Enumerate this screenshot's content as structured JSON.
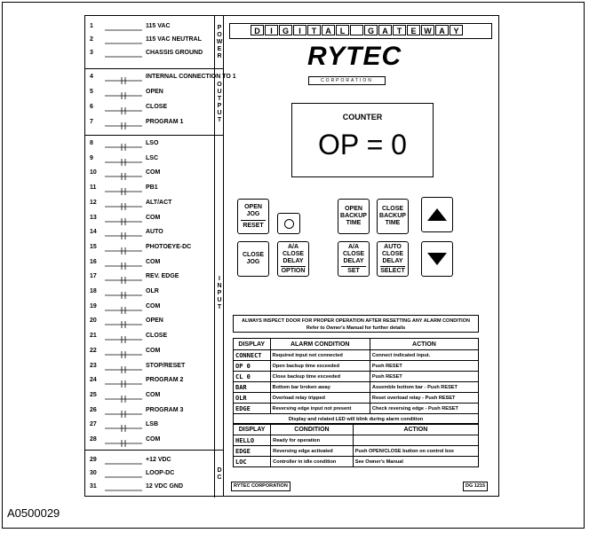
{
  "figure_id": "A0500029",
  "power": {
    "label": "POWER",
    "rows": [
      {
        "num": "1",
        "label": "115 VAC"
      },
      {
        "num": "2",
        "label": "115 VAC NEUTRAL"
      },
      {
        "num": "3",
        "label": "CHASSIS GROUND"
      }
    ]
  },
  "output": {
    "label": "OUTPUT",
    "rows": [
      {
        "num": "4",
        "label": "INTERNAL CONNECTION TO 1"
      },
      {
        "num": "5",
        "label": "OPEN"
      },
      {
        "num": "6",
        "label": "CLOSE"
      },
      {
        "num": "7",
        "label": "PROGRAM 1"
      }
    ]
  },
  "input": {
    "label": "INPUT",
    "rows": [
      {
        "num": "8",
        "label": "LSO"
      },
      {
        "num": "9",
        "label": "LSC"
      },
      {
        "num": "10",
        "label": "COM"
      },
      {
        "num": "11",
        "label": "PB1"
      },
      {
        "num": "12",
        "label": "ALT/ACT"
      },
      {
        "num": "13",
        "label": "COM"
      },
      {
        "num": "14",
        "label": "AUTO"
      },
      {
        "num": "15",
        "label": "PHOTOEYE-DC"
      },
      {
        "num": "16",
        "label": "COM"
      },
      {
        "num": "17",
        "label": "REV. EDGE"
      },
      {
        "num": "18",
        "label": "OLR"
      },
      {
        "num": "19",
        "label": "COM"
      },
      {
        "num": "20",
        "label": "OPEN"
      },
      {
        "num": "21",
        "label": "CLOSE"
      },
      {
        "num": "22",
        "label": "COM"
      },
      {
        "num": "23",
        "label": "STOP/RESET"
      },
      {
        "num": "24",
        "label": "PROGRAM 2"
      },
      {
        "num": "25",
        "label": "COM"
      },
      {
        "num": "26",
        "label": "PROGRAM 3"
      },
      {
        "num": "27",
        "label": "LSB"
      },
      {
        "num": "28",
        "label": "COM"
      }
    ]
  },
  "dc": {
    "label": "DC",
    "rows": [
      {
        "num": "29",
        "label": "+12 VDC"
      },
      {
        "num": "30",
        "label": "LOOP-DC"
      },
      {
        "num": "31",
        "label": "12 VDC GND"
      }
    ]
  },
  "brand": {
    "letters": [
      "D",
      "I",
      "G",
      "I",
      "T",
      "A",
      "L",
      "",
      "G",
      "A",
      "T",
      "E",
      "W",
      "A",
      "Y"
    ],
    "logo": "RYTEC",
    "logo_sub": "CORPORATION"
  },
  "counter": {
    "title": "COUNTER",
    "value": "OP  =  0"
  },
  "buttons": {
    "open_jog_reset": {
      "l1": "OPEN",
      "l2": "JOG",
      "l3": "RESET"
    },
    "open_backup": {
      "l1": "OPEN",
      "l2": "BACKUP",
      "l3": "TIME"
    },
    "close_backup": {
      "l1": "CLOSE",
      "l2": "BACKUP",
      "l3": "TIME"
    },
    "close_jog": {
      "l1": "CLOSE",
      "l2": "JOG"
    },
    "aa_option": {
      "l1": "A/A",
      "l2": "CLOSE",
      "l3": "DELAY",
      "l4": "OPTION"
    },
    "aa_set": {
      "l1": "A/A",
      "l2": "CLOSE",
      "l3": "DELAY",
      "l4": "SET"
    },
    "auto_select": {
      "l1": "AUTO",
      "l2": "CLOSE",
      "l3": "DELAY",
      "l4": "SELECT"
    }
  },
  "warning": {
    "l1": "ALWAYS INSPECT DOOR FOR PROPER OPERATION AFTER RESETTING ANY ALARM CONDITION",
    "l2": "Refer to Owner's Manual for further details"
  },
  "alarm_table": {
    "headers": [
      "DISPLAY",
      "ALARM CONDITION",
      "ACTION"
    ],
    "rows": [
      [
        "CONNECT",
        "Required input not connected",
        "Connect indicated input."
      ],
      [
        "OP    0",
        "Open backup time exceeded",
        "Push RESET"
      ],
      [
        "CL    0",
        "Close backup time exceeded",
        "Push RESET"
      ],
      [
        "BAR",
        "Bottom bar broken away",
        "Assemble bottom bar - Push RESET"
      ],
      [
        "OLR",
        "Overload relay tripped",
        "Reset overload relay - Push RESET"
      ],
      [
        "EDGE",
        "Reversing edge input not present",
        "Check reversing edge - Push RESET"
      ]
    ],
    "note": "Display and related LED will blink during alarm condition"
  },
  "status_table": {
    "headers": [
      "DISPLAY",
      "CONDITION",
      "ACTION"
    ],
    "rows": [
      [
        "HELLO",
        "Ready for operation",
        ""
      ],
      [
        "EDGE",
        "Reversing edge activated",
        "Push OPEN/CLOSE button on control box"
      ],
      [
        "LOC",
        "Controller in idle condition",
        "See Owner's Manual"
      ]
    ]
  },
  "footer": {
    "left": "RYTEC CORPORATION",
    "right": "DG 1215"
  }
}
